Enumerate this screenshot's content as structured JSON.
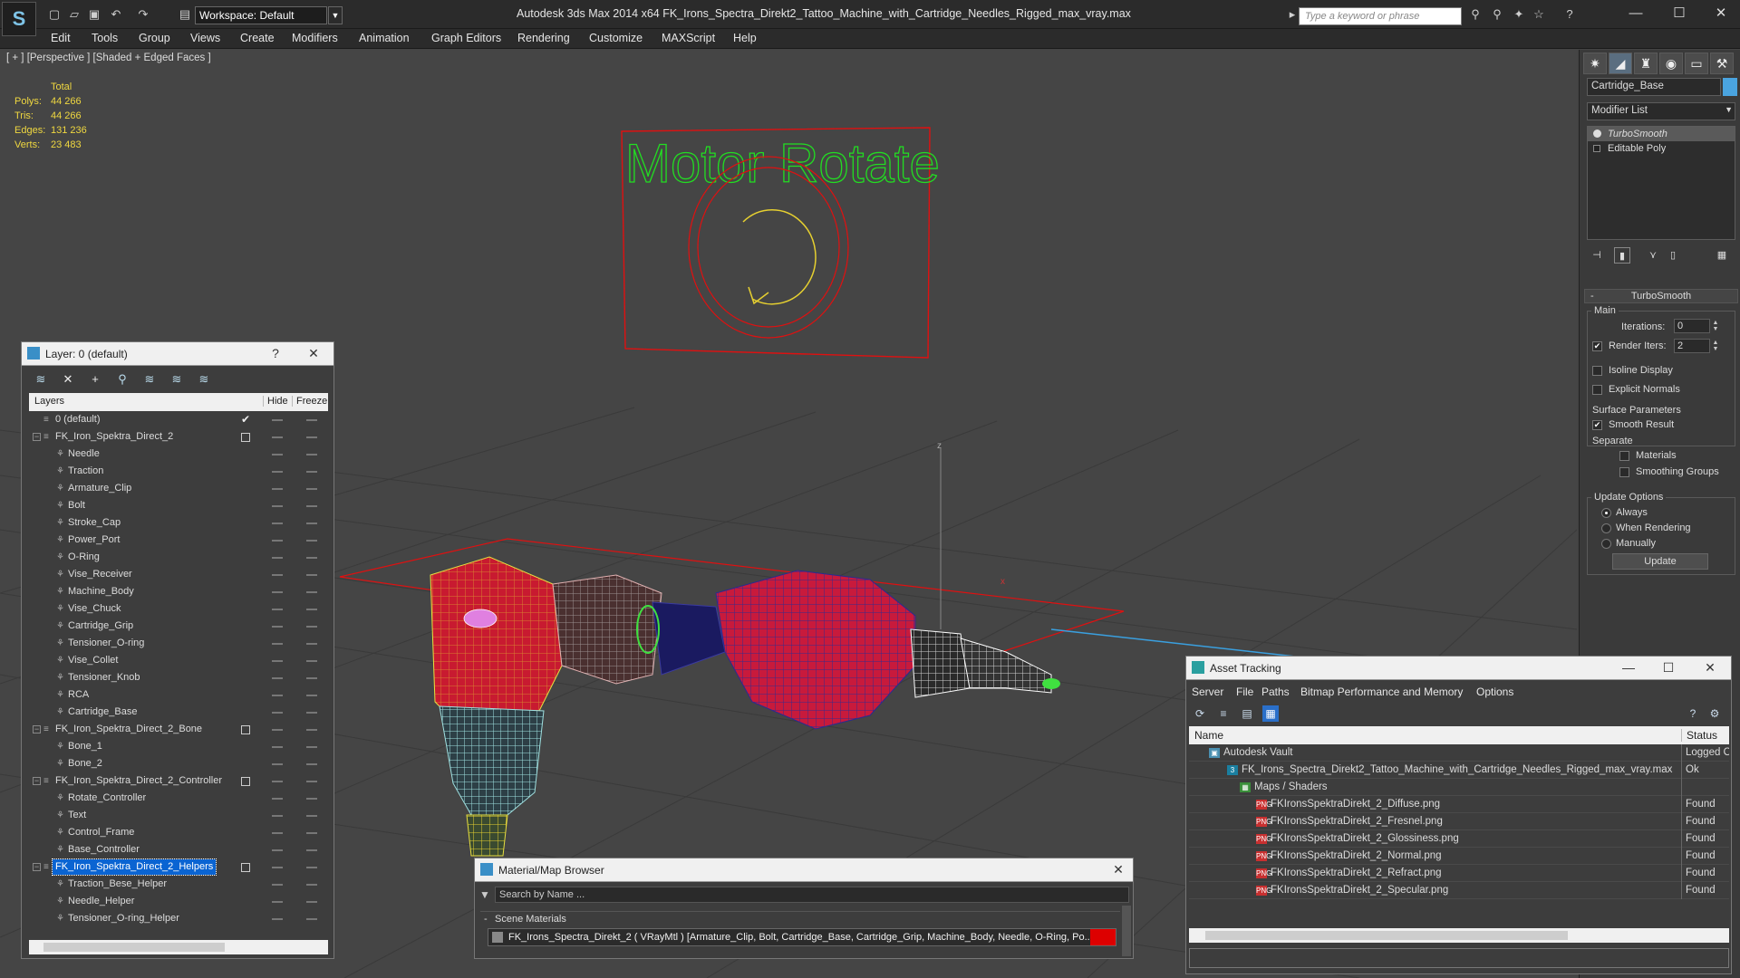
{
  "app": {
    "title": "Autodesk 3ds Max  2014 x64      FK_Irons_Spectra_Direkt2_Tattoo_Machine_with_Cartridge_Needles_Rigged_max_vray.max",
    "workspace": "Workspace: Default",
    "search_placeholder": "Type a keyword or phrase",
    "logo": "S"
  },
  "menu": [
    "Edit",
    "Tools",
    "Group",
    "Views",
    "Create",
    "Modifiers",
    "Animation",
    "Graph Editors",
    "Rendering",
    "Customize",
    "MAXScript",
    "Help"
  ],
  "viewport": {
    "label": "[ + ] [Perspective ] [Shaded + Edged Faces ]",
    "stats_header": "Total",
    "stats": [
      {
        "label": "Polys:",
        "value": "44 266"
      },
      {
        "label": "Tris:",
        "value": "44 266"
      },
      {
        "label": "Edges:",
        "value": "131 236"
      },
      {
        "label": "Verts:",
        "value": "23 483"
      }
    ],
    "sign_text": "Motor Rotate",
    "axis_z": "z",
    "axis_x": "x"
  },
  "command_panel": {
    "object_name": "Cartridge_Base",
    "object_color": "#4aa4e0",
    "modifier_list": "Modifier List",
    "stack": [
      "TurboSmooth",
      "Editable Poly"
    ],
    "rollout_title": "TurboSmooth",
    "main_group": "Main",
    "iterations_label": "Iterations:",
    "iterations_value": "0",
    "render_iters_label": "Render Iters:",
    "render_iters_value": "2",
    "isoline": "Isoline Display",
    "explicit_normals": "Explicit Normals",
    "surface_params": "Surface Parameters",
    "smooth_result": "Smooth Result",
    "separate": "Separate",
    "materials": "Materials",
    "smoothing_groups": "Smoothing Groups",
    "update_options": "Update Options",
    "always": "Always",
    "when_rendering": "When Rendering",
    "manually": "Manually",
    "update_btn": "Update"
  },
  "layer_panel": {
    "title": "Layer: 0 (default)",
    "help": "?",
    "close": "✕",
    "col_layers": "Layers",
    "col_hide": "Hide",
    "col_freeze": "Freeze",
    "rows": [
      {
        "name": "0 (default)",
        "level": 0,
        "type": "layer",
        "active": true
      },
      {
        "name": "FK_Iron_Spektra_Direct_2",
        "level": 0,
        "type": "layer",
        "expand": "−"
      },
      {
        "name": "Needle",
        "level": 1,
        "type": "obj"
      },
      {
        "name": "Traction",
        "level": 1,
        "type": "obj"
      },
      {
        "name": "Armature_Clip",
        "level": 1,
        "type": "obj"
      },
      {
        "name": "Bolt",
        "level": 1,
        "type": "obj"
      },
      {
        "name": "Stroke_Cap",
        "level": 1,
        "type": "obj"
      },
      {
        "name": "Power_Port",
        "level": 1,
        "type": "obj"
      },
      {
        "name": "O-Ring",
        "level": 1,
        "type": "obj"
      },
      {
        "name": "Vise_Receiver",
        "level": 1,
        "type": "obj"
      },
      {
        "name": "Machine_Body",
        "level": 1,
        "type": "obj"
      },
      {
        "name": "Vise_Chuck",
        "level": 1,
        "type": "obj"
      },
      {
        "name": "Cartridge_Grip",
        "level": 1,
        "type": "obj"
      },
      {
        "name": "Tensioner_O-ring",
        "level": 1,
        "type": "obj"
      },
      {
        "name": "Vise_Collet",
        "level": 1,
        "type": "obj"
      },
      {
        "name": "Tensioner_Knob",
        "level": 1,
        "type": "obj"
      },
      {
        "name": "RCA",
        "level": 1,
        "type": "obj"
      },
      {
        "name": "Cartridge_Base",
        "level": 1,
        "type": "obj"
      },
      {
        "name": "FK_Iron_Spektra_Direct_2_Bone",
        "level": 0,
        "type": "layer",
        "expand": "−"
      },
      {
        "name": "Bone_1",
        "level": 1,
        "type": "obj"
      },
      {
        "name": "Bone_2",
        "level": 1,
        "type": "obj"
      },
      {
        "name": "FK_Iron_Spektra_Direct_2_Controller",
        "level": 0,
        "type": "layer",
        "expand": "−"
      },
      {
        "name": "Rotate_Controller",
        "level": 1,
        "type": "obj"
      },
      {
        "name": "Text",
        "level": 1,
        "type": "obj"
      },
      {
        "name": "Control_Frame",
        "level": 1,
        "type": "obj"
      },
      {
        "name": "Base_Controller",
        "level": 1,
        "type": "obj"
      },
      {
        "name": "FK_Iron_Spektra_Direct_2_Helpers",
        "level": 0,
        "type": "layer",
        "expand": "−",
        "selected": true
      },
      {
        "name": "Traction_Bese_Helper",
        "level": 1,
        "type": "obj"
      },
      {
        "name": "Needle_Helper",
        "level": 1,
        "type": "obj"
      },
      {
        "name": "Tensioner_O-ring_Helper",
        "level": 1,
        "type": "obj"
      }
    ]
  },
  "material_browser": {
    "title": "Material/Map Browser",
    "search_placeholder": "Search by Name ...",
    "section": "Scene Materials",
    "item": "FK_Irons_Spectra_Direkt_2  ( VRayMtl )  [Armature_Clip, Bolt, Cartridge_Base, Cartridge_Grip, Machine_Body, Needle, O-Ring, Po..."
  },
  "asset_tracking": {
    "title": "Asset Tracking",
    "menu": [
      "Server",
      "File",
      "Paths",
      "Bitmap Performance and Memory",
      "Options"
    ],
    "col_name": "Name",
    "col_status": "Status",
    "rows": [
      {
        "name": "Autodesk Vault",
        "indent": 22,
        "status": "Logged O",
        "icon": "vault"
      },
      {
        "name": "FK_Irons_Spectra_Direkt2_Tattoo_Machine_with_Cartridge_Needles_Rigged_max_vray.max",
        "indent": 42,
        "status": "Ok",
        "icon": "max"
      },
      {
        "name": "Maps / Shaders",
        "indent": 56,
        "status": "",
        "icon": "maps"
      },
      {
        "name": "FKIronsSpektraDirekt_2_Diffuse.png",
        "indent": 74,
        "status": "Found",
        "icon": "png"
      },
      {
        "name": "FKIronsSpektraDirekt_2_Fresnel.png",
        "indent": 74,
        "status": "Found",
        "icon": "png"
      },
      {
        "name": "FKIronsSpektraDirekt_2_Glossiness.png",
        "indent": 74,
        "status": "Found",
        "icon": "png"
      },
      {
        "name": "FKIronsSpektraDirekt_2_Normal.png",
        "indent": 74,
        "status": "Found",
        "icon": "png"
      },
      {
        "name": "FKIronsSpektraDirekt_2_Refract.png",
        "indent": 74,
        "status": "Found",
        "icon": "png"
      },
      {
        "name": "FKIronsSpektraDirekt_2_Specular.png",
        "indent": 74,
        "status": "Found",
        "icon": "png"
      }
    ]
  }
}
